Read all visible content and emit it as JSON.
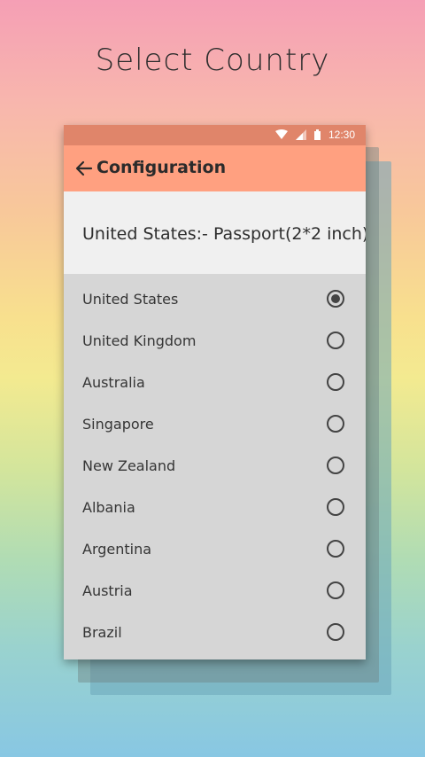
{
  "headline": "Select Country",
  "status": {
    "time": "12:30"
  },
  "appbar": {
    "title": "Configuration"
  },
  "summary": {
    "text": "United States:- Passport(2*2 inch)"
  },
  "countries": [
    {
      "label": "United States",
      "selected": true
    },
    {
      "label": "United Kingdom",
      "selected": false
    },
    {
      "label": "Australia",
      "selected": false
    },
    {
      "label": "Singapore",
      "selected": false
    },
    {
      "label": "New Zealand",
      "selected": false
    },
    {
      "label": "Albania",
      "selected": false
    },
    {
      "label": "Argentina",
      "selected": false
    },
    {
      "label": "Austria",
      "selected": false
    },
    {
      "label": "Brazil",
      "selected": false
    }
  ],
  "colors": {
    "status_bar": "#e0856a",
    "app_bar": "#ffa080",
    "list_bg": "#d6d6d6",
    "summary_bg": "#f0f0f0"
  }
}
